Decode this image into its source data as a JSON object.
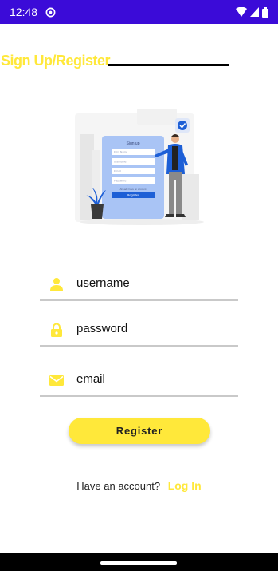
{
  "status_bar": {
    "time": "12:48",
    "icons": [
      "sync-icon",
      "wifi-icon",
      "signal-icon",
      "battery-icon"
    ],
    "background": "#3b0bd8"
  },
  "header": {
    "title": "Sign Up/Register",
    "title_color": "#ffe83a"
  },
  "illustration": {
    "form_title": "Sign up",
    "fields": [
      "First Name",
      "username",
      "Email",
      "Password"
    ],
    "link_text": "Already have an account",
    "button_label": "Register",
    "icons": [
      "checkmark-badge-icon",
      "potted-plant-icon",
      "person-icon"
    ]
  },
  "form": {
    "username_placeholder": "username",
    "password_placeholder": "password",
    "email_placeholder": "email",
    "field_icons": [
      "person-icon",
      "lock-icon",
      "mail-icon"
    ],
    "icon_color": "#ffe83a"
  },
  "register": {
    "label": "Register",
    "color": "#ffe83a"
  },
  "footer": {
    "account_text": "Have an account?",
    "login_label": "Log In"
  }
}
